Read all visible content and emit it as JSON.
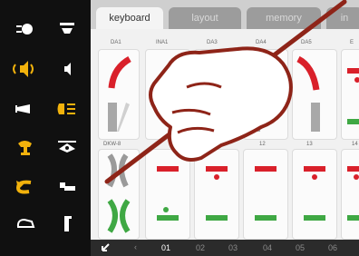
{
  "tabs": [
    {
      "label": "keyboard",
      "active": true
    },
    {
      "label": "layout",
      "active": false
    },
    {
      "label": "memory",
      "active": false
    },
    {
      "label": "in",
      "active": false
    }
  ],
  "row1_headers": [
    "DA1",
    "INA1",
    "DA3",
    "DA4",
    "DA5",
    "E"
  ],
  "row2_headers": [
    "DKW-8",
    "",
    "",
    "12",
    "13",
    "14"
  ],
  "pager": {
    "prev_icon": "arrow-left-icon",
    "pages": [
      "01",
      "02",
      "03",
      "04",
      "05",
      "06"
    ],
    "selected": "01"
  },
  "left_panel_icons": [
    "headlight-icon",
    "light-beam-icon",
    "horn-sound-icon",
    "mute-sound-icon",
    "whistle-horn-icon",
    "cab-light-icon",
    "bell-icon",
    "interior-light-icon",
    "shunting-icon",
    "coupler-icon",
    "loco-front-icon",
    "pantograph-icon"
  ],
  "colors": {
    "accent_yellow": "#f2b20c",
    "signal_red": "#d9202a",
    "signal_green": "#3fa844",
    "overlay_hand": "#8e2418"
  }
}
